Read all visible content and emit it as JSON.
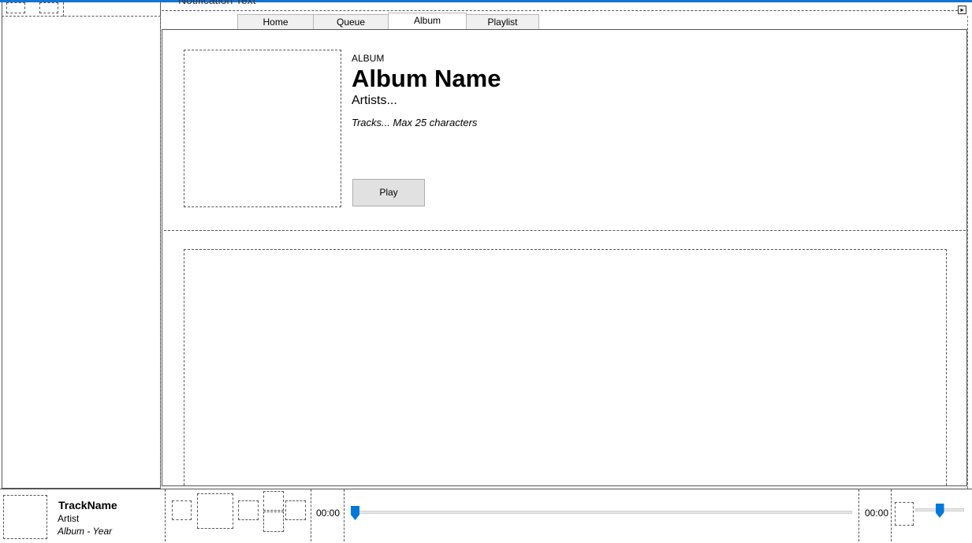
{
  "notification": {
    "text": "Notification Text"
  },
  "tabs": [
    {
      "label": "Home"
    },
    {
      "label": "Queue"
    },
    {
      "label": "Album"
    },
    {
      "label": "Playlist"
    }
  ],
  "active_tab": "Album",
  "album": {
    "kicker": "ALBUM",
    "name": "Album Name",
    "artists": "Artists...",
    "tracks": "Tracks... Max 25 characters",
    "play_label": "Play"
  },
  "now_playing": {
    "track_name": "TrackName",
    "artist": "Artist",
    "album_year": "Album - Year"
  },
  "player": {
    "elapsed": "00:00",
    "duration": "00:00",
    "seek_fraction": 0,
    "volume_fraction": 0.5
  },
  "colors": {
    "accent": "#0078d7",
    "topbar": "#1573d6"
  }
}
